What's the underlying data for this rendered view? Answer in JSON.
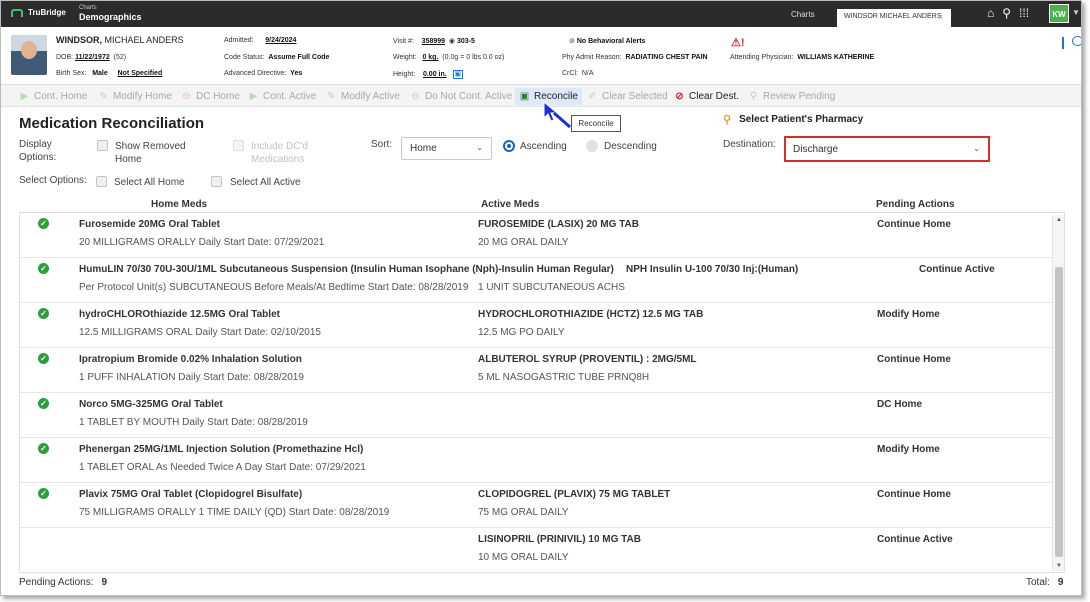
{
  "topbar": {
    "brand": "TruBridge",
    "app_small": "Charts",
    "app_title": "Demographics",
    "tab_charts": "Charts",
    "tab_patient": "WINDSOR MICHAEL ANDERS",
    "user_initials": "KW",
    "icons": [
      "home-icon",
      "search-icon",
      "apps-grid-icon"
    ]
  },
  "patient": {
    "last_name": "WINDSOR,",
    "first_name": " MICHAEL ANDERS",
    "dob_label": "DOB:",
    "dob": "11/22/1972",
    "age": "(52)",
    "birth_sex_label": "Birth Sex:",
    "birth_sex": "Male",
    "gender_value": "Not Specified",
    "admitted_label": "Admitted:",
    "admitted": "9/24/2024",
    "code_status_label": "Code Status:",
    "code_status": "Assume Full Code",
    "adv_dir_label": "Advanced Directive:",
    "adv_dir": "Yes",
    "visit_label": "Visit #:",
    "visit": "358999",
    "room": "303-5",
    "weight_label": "Weight:",
    "weight": "0 kg.",
    "weight_detail": "(0.0g = 0 lbs 0.0 oz)",
    "height_label": "Height:",
    "height": "0.00 in.",
    "behavioral": "No Behavioral Alerts",
    "admit_reason_label": "Phy Admit Reason:",
    "admit_reason": "RADIATING CHEST PAIN",
    "crcl_label": "CrCl:",
    "crcl": "N/A",
    "attending_label": "Attending Physician:",
    "attending": "WILLIAMS KATHERINE"
  },
  "toolbar": {
    "cont_home": "Cont. Home",
    "modify_home": "Modify Home",
    "dc_home": "DC Home",
    "cont_active": "Cont. Active",
    "modify_active": "Modify Active",
    "do_not_cont_active": "Do Not Cont. Active",
    "reconcile": "Reconcile",
    "clear_selected": "Clear Selected",
    "clear_dest": "Clear Dest.",
    "review_pending": "Review Pending",
    "tooltip": "Reconcile"
  },
  "page": {
    "title": "Medication Reconciliation",
    "display_options_label": "Display Options:",
    "show_removed_home": "Show Removed Home",
    "include_dc_meds": "Include DC'd Medications",
    "sort_label": "Sort:",
    "sort_value": "Home",
    "ascending": "Ascending",
    "descending": "Descending",
    "select_options_label": "Select Options:",
    "select_all_home": "Select All Home",
    "select_all_active": "Select All Active",
    "pharmacy": "Select Patient's Pharmacy",
    "destination_label": "Destination:",
    "destination_value": "Discharge"
  },
  "table": {
    "headers": {
      "home": "Home Meds",
      "active": "Active Meds",
      "pending": "Pending Actions"
    },
    "rows": [
      {
        "checked": true,
        "home_name": "Furosemide 20MG Oral Tablet",
        "home_detail": "20 MILLIGRAMS ORALLY Daily Start Date: 07/29/2021",
        "active_name": "FUROSEMIDE (LASIX) 20 MG TAB",
        "active_detail": "20 MG ORAL DAILY",
        "pending": "Continue Home"
      },
      {
        "checked": true,
        "home_name": "HumuLIN 70/30 70U-30U/1ML Subcutaneous Suspension (Insulin Human Isophane (Nph)-Insulin Human Regular)",
        "home_detail": "Per Protocol Unit(s) SUBCUTANEOUS Before Meals/At Bedtime Start Date: 08/28/2019",
        "active_name": "NPH Insulin U-100 70/30 Inj:(Human)",
        "active_detail": "1 UNIT SUBCUTANEOUS ACHS",
        "pending": "Continue Active"
      },
      {
        "checked": true,
        "home_name": "hydroCHLOROthiazide 12.5MG Oral Tablet",
        "home_detail": "12.5 MILLIGRAMS ORAL Daily Start Date: 02/10/2015",
        "active_name": "HYDROCHLOROTHIAZIDE (HCTZ) 12.5 MG TAB",
        "active_detail": "12.5 MG PO DAILY",
        "pending": "Modify Home"
      },
      {
        "checked": true,
        "home_name": "Ipratropium Bromide 0.02% Inhalation Solution",
        "home_detail": "1 PUFF INHALATION Daily Start Date: 08/28/2019",
        "active_name": "ALBUTEROL SYRUP (PROVENTIL) : 2MG/5ML",
        "active_detail": "5 ML NASOGASTRIC TUBE PRNQ8H",
        "pending": "Continue Home"
      },
      {
        "checked": true,
        "home_name": "Norco 5MG-325MG Oral Tablet",
        "home_detail": "1 TABLET BY MOUTH Daily Start Date: 08/28/2019",
        "active_name": "",
        "active_detail": "",
        "pending": "DC Home"
      },
      {
        "checked": true,
        "home_name": "Phenergan 25MG/1ML Injection Solution (Promethazine Hcl)",
        "home_detail": "1 TABLET ORAL As Needed Twice A Day Start Date: 07/29/2021",
        "active_name": "",
        "active_detail": "",
        "pending": "Modify Home"
      },
      {
        "checked": true,
        "home_name": "Plavix 75MG Oral Tablet (Clopidogrel Bisulfate)",
        "home_detail": "75 MILLIGRAMS ORALLY 1 TIME DAILY (QD) Start Date: 08/28/2019",
        "active_name": "CLOPIDOGREL (PLAVIX) 75 MG TABLET",
        "active_detail": "75 MG ORAL DAILY",
        "pending": "Continue Home"
      },
      {
        "checked": false,
        "home_name": "",
        "home_detail": "",
        "active_name": "LISINOPRIL (PRINIVIL) 10 MG TAB",
        "active_detail": "10 MG ORAL DAILY",
        "pending": "Continue Active"
      }
    ]
  },
  "footer": {
    "pending_label": "Pending Actions:",
    "pending_count": "9",
    "total_label": "Total:",
    "total_count": "9"
  },
  "colors": {
    "accent": "#1565c0",
    "success": "#2e9e3a",
    "danger": "#d32f2f",
    "topbar": "#2b2b2b"
  }
}
